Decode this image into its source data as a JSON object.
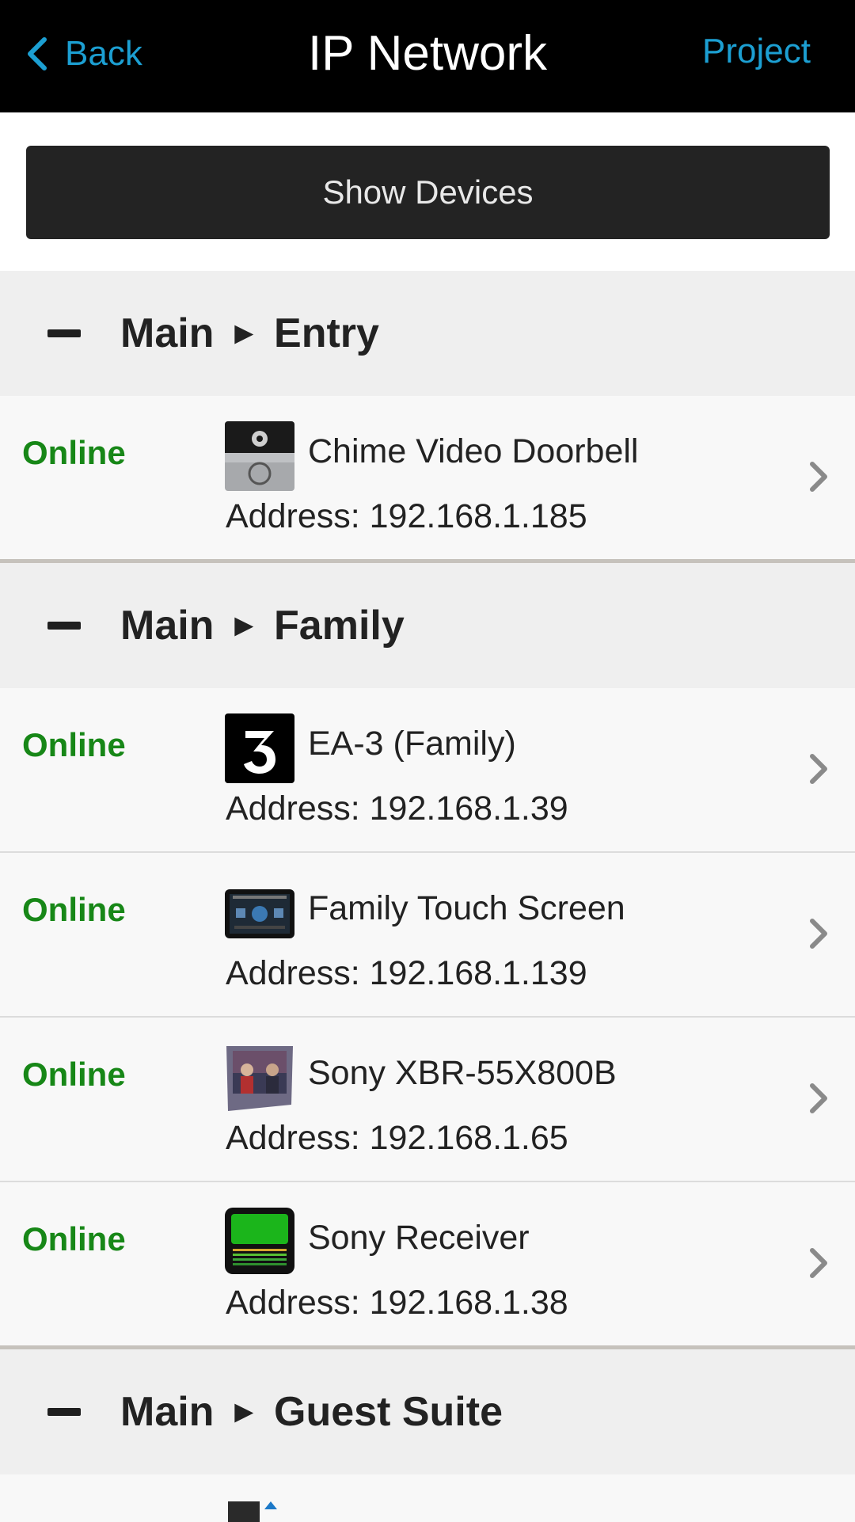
{
  "header": {
    "back_label": "Back",
    "title": "IP Network",
    "project_label": "Project"
  },
  "show_devices_label": "Show Devices",
  "groups": [
    {
      "floor": "Main",
      "room": "Entry",
      "devices": [
        {
          "status": "Online",
          "name": "Chime Video Doorbell",
          "address": "Address: 192.168.1.185",
          "icon": "doorbell-icon"
        }
      ]
    },
    {
      "floor": "Main",
      "room": "Family",
      "devices": [
        {
          "status": "Online",
          "name": "EA-3 (Family)",
          "address": "Address: 192.168.1.39",
          "icon": "controller-ea3-icon"
        },
        {
          "status": "Online",
          "name": "Family Touch Screen",
          "address": "Address: 192.168.1.139",
          "icon": "touch-screen-icon"
        },
        {
          "status": "Online",
          "name": "Sony XBR-55X800B",
          "address": "Address: 192.168.1.65",
          "icon": "tv-icon"
        },
        {
          "status": "Online",
          "name": "Sony Receiver",
          "address": "Address: 192.168.1.38",
          "icon": "receiver-icon"
        }
      ]
    },
    {
      "floor": "Main",
      "room": "Guest Suite",
      "devices": []
    }
  ],
  "colors": {
    "accent": "#1c9fd2",
    "online": "#178717",
    "header_bg": "#000000",
    "group_bg": "#efefef",
    "row_bg": "#f8f8f8",
    "button_bg": "#232323"
  }
}
